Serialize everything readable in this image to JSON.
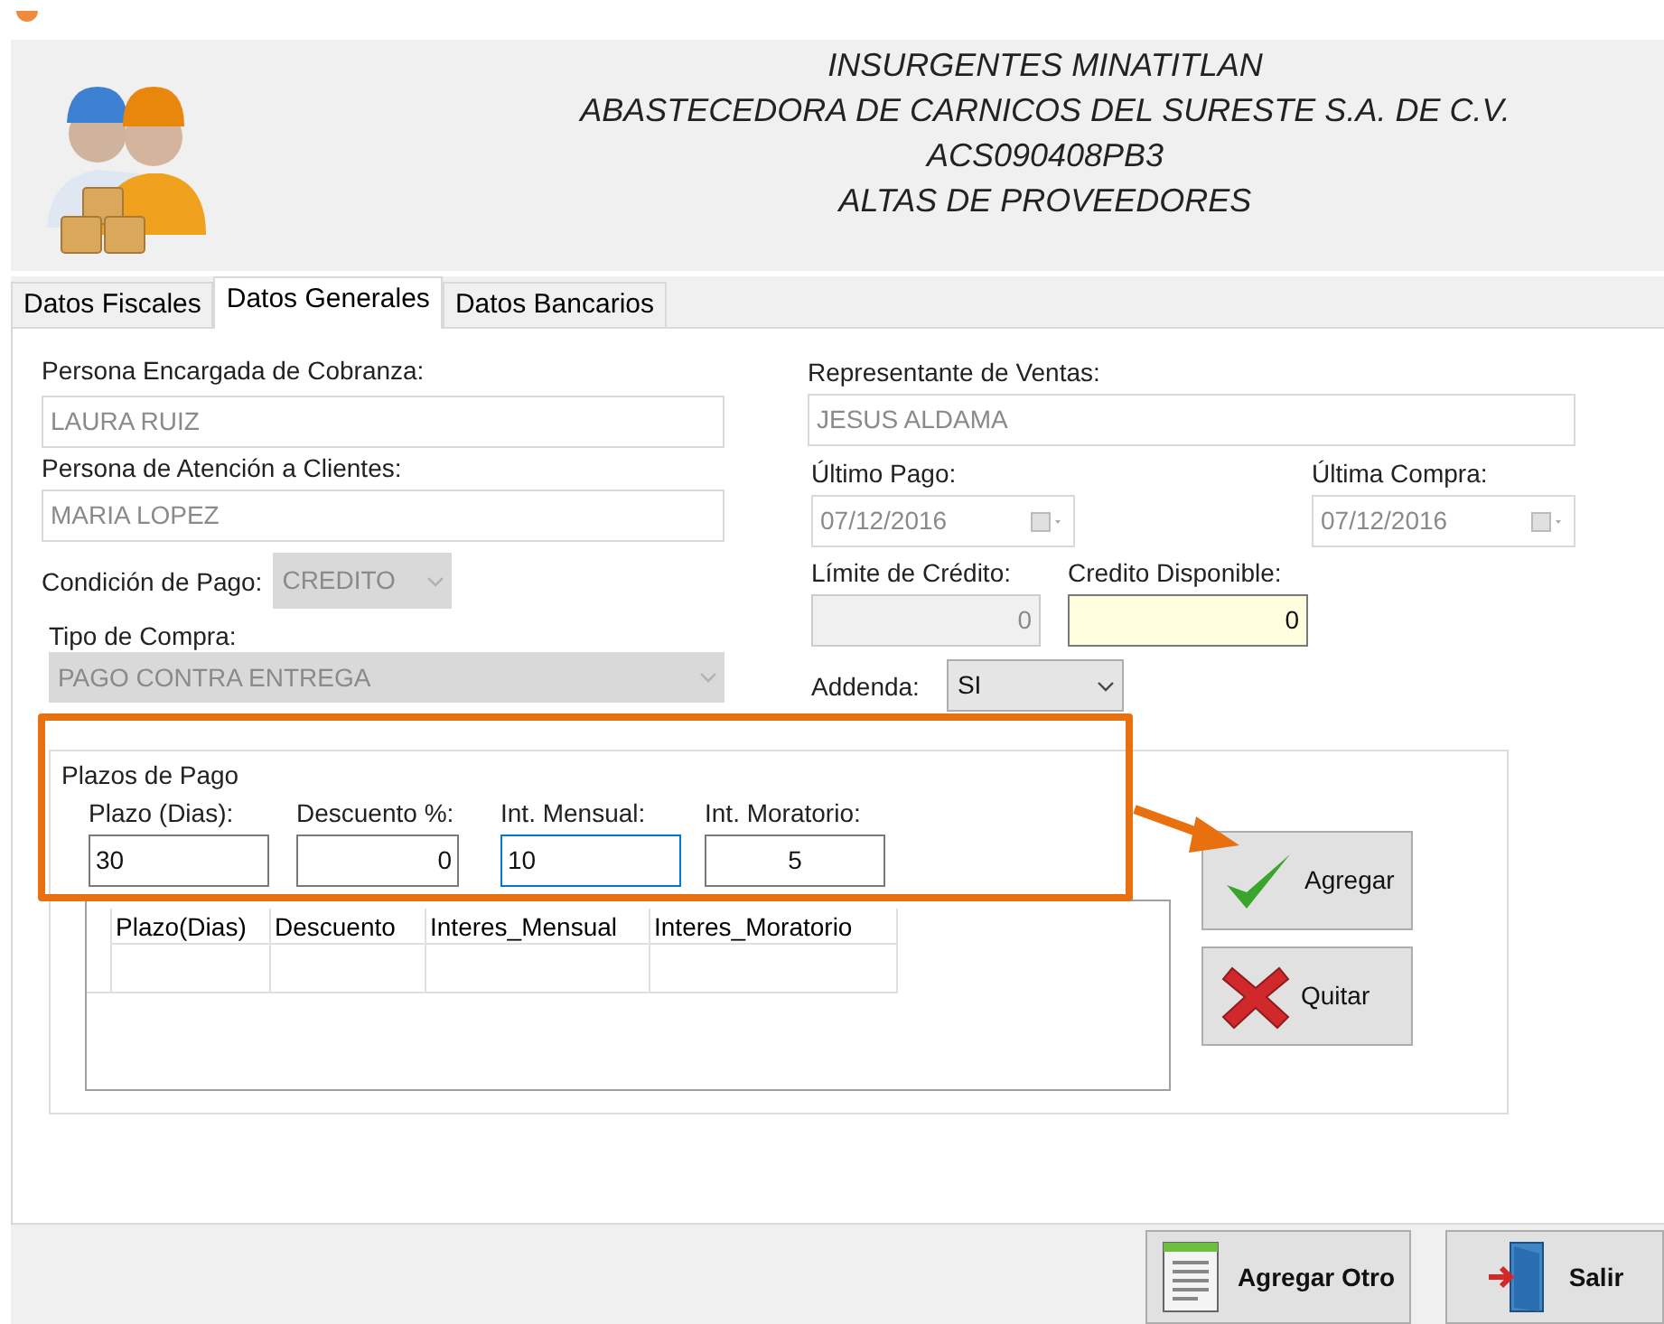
{
  "header": {
    "lines": [
      "INSURGENTES MINATITLAN",
      "ABASTECEDORA DE CARNICOS DEL SURESTE S.A. DE C.V.",
      "ACS090408PB3",
      "ALTAS DE PROVEEDORES"
    ]
  },
  "tabs": [
    {
      "label": "Datos Fiscales",
      "selected": false
    },
    {
      "label": "Datos Generales",
      "selected": true
    },
    {
      "label": "Datos Bancarios",
      "selected": false
    }
  ],
  "cobranza": {
    "label": "Persona Encargada de Cobranza:",
    "value": "LAURA RUIZ",
    "disabled": true
  },
  "atencion": {
    "label": "Persona de Atención a Clientes:",
    "value": "MARIA LOPEZ",
    "disabled": true
  },
  "condicion_pago": {
    "label": "Condición de Pago:",
    "value": "CREDITO",
    "disabled": true
  },
  "tipo_compra": {
    "label": "Tipo de Compra:",
    "value": "PAGO CONTRA ENTREGA",
    "disabled": true
  },
  "representante": {
    "label": "Representante de Ventas:",
    "value": "JESUS ALDAMA",
    "disabled": true
  },
  "ultimo_pago": {
    "label": "Último Pago:",
    "value": "07/12/2016",
    "disabled": true
  },
  "ultima_compra": {
    "label": "Última Compra:",
    "value": "07/12/2016",
    "disabled": true
  },
  "limite_credito": {
    "label": "Límite de Crédito:",
    "value": "0",
    "disabled": true
  },
  "credito_disponible": {
    "label": "Credito Disponible:",
    "value": "0",
    "disabled": false,
    "highlighted": true
  },
  "addenda": {
    "label": "Addenda:",
    "value": "SI",
    "disabled": false
  },
  "plazos": {
    "title": "Plazos de Pago",
    "inputs": [
      {
        "label": "Plazo (Dias):",
        "value": "30",
        "focused": false
      },
      {
        "label": "Descuento %:",
        "value": "0",
        "focused": false
      },
      {
        "label": "Int. Mensual:",
        "value": "10",
        "focused": true
      },
      {
        "label": "Int. Moratorio:",
        "value": "5",
        "focused": false
      }
    ],
    "columns": [
      "Plazo(Dias)",
      "Descuento",
      "Interes_Mensual",
      "Interes_Moratorio"
    ],
    "buttons": [
      {
        "label": "Agregar",
        "kind": "add"
      },
      {
        "label": "Quitar",
        "kind": "remove"
      }
    ]
  },
  "footer_buttons": [
    {
      "label": "Agregar Otro",
      "kind": "document"
    },
    {
      "label": "Salir",
      "kind": "exit"
    }
  ]
}
